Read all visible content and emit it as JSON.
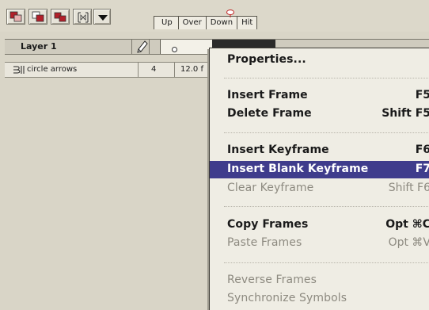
{
  "toolbar": {
    "tabs": [
      "Up",
      "Over",
      "Down",
      "Hit"
    ]
  },
  "timeline": {
    "layer_name": "Layer 1",
    "status": {
      "layer_label": "circle arrows",
      "frame": "4",
      "fps": "12.0 f"
    }
  },
  "context_menu": {
    "items": [
      {
        "label": "Properties...",
        "shortcut": "",
        "state": "enabled"
      },
      {
        "label": "Insert Frame",
        "shortcut": "F5",
        "state": "enabled"
      },
      {
        "label": "Delete Frame",
        "shortcut": "Shift F5",
        "state": "enabled"
      },
      {
        "label": "Insert Keyframe",
        "shortcut": "F6",
        "state": "enabled"
      },
      {
        "label": "Insert Blank Keyframe",
        "shortcut": "F7",
        "state": "selected"
      },
      {
        "label": "Clear Keyframe",
        "shortcut": "Shift F6",
        "state": "disabled"
      },
      {
        "label": "Copy Frames",
        "shortcut": "Opt ⌘C",
        "state": "enabled"
      },
      {
        "label": "Paste Frames",
        "shortcut": "Opt ⌘V",
        "state": "disabled"
      },
      {
        "label": "Reverse Frames",
        "shortcut": "",
        "state": "disabled"
      },
      {
        "label": "Synchronize Symbols",
        "shortcut": "",
        "state": "disabled"
      }
    ]
  },
  "colors": {
    "selection": "#3f3c8c",
    "background": "#d9d5c7",
    "menu_bg": "#efede4",
    "disabled_text": "#8d8a80",
    "icon_red": "#b3202a"
  }
}
